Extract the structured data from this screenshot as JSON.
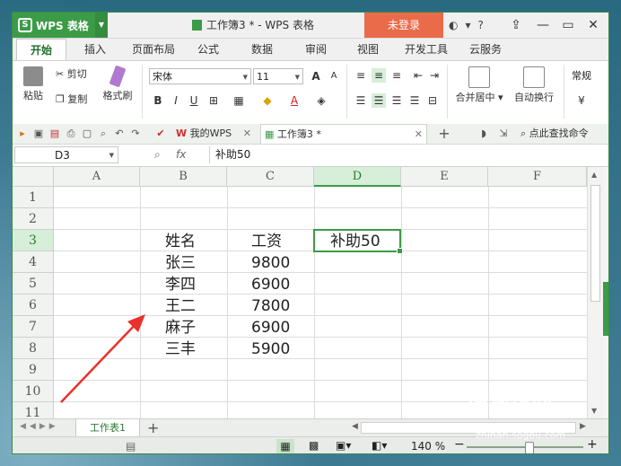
{
  "app": {
    "logo_text": "WPS 表格",
    "doc_title": "工作簿3 * - WPS 表格",
    "login_label": "未登录",
    "help_label": "?"
  },
  "ribbon_tabs": [
    "开始",
    "插入",
    "页面布局",
    "公式",
    "数据",
    "审阅",
    "视图",
    "开发工具",
    "云服务"
  ],
  "ribbon": {
    "paste": "粘贴",
    "cut": "剪切",
    "copy": "复制",
    "format_painter": "格式刷",
    "font_name": "宋体",
    "font_size": "11",
    "bold": "B",
    "italic": "I",
    "underline": "U",
    "merge_center": "合并居中",
    "wrap_text": "自动换行",
    "number_format": "常规",
    "font_grow": "A",
    "font_shrink": "A"
  },
  "doc_tabs": {
    "wps": "我的WPS",
    "current": "工作簿3 *",
    "search": "点此查找命令"
  },
  "formula_bar": {
    "cell_ref": "D3",
    "fx": "fx",
    "content": "补助50"
  },
  "grid": {
    "columns": [
      "A",
      "B",
      "C",
      "D",
      "E",
      "F"
    ],
    "rows": [
      "1",
      "2",
      "3",
      "4",
      "5",
      "6",
      "7",
      "8",
      "9",
      "10",
      "11"
    ],
    "header_name": "姓名",
    "header_salary": "工资",
    "header_extra": "补助50",
    "names": [
      "张三",
      "李四",
      "王二",
      "麻子",
      "三丰"
    ],
    "salaries": [
      "9800",
      "6900",
      "7800",
      "6900",
      "5900"
    ]
  },
  "sheet": {
    "tab_name": "工作表1",
    "add": "+"
  },
  "status": {
    "zoom": "140 %",
    "minus": "−",
    "plus": "+"
  },
  "watermark": {
    "brand": "搜狗指南",
    "url": "zhinan.sogou.com"
  },
  "colors": {
    "accent": "#3b9b47",
    "login": "#ea6b49",
    "arrow": "#e8322b"
  }
}
